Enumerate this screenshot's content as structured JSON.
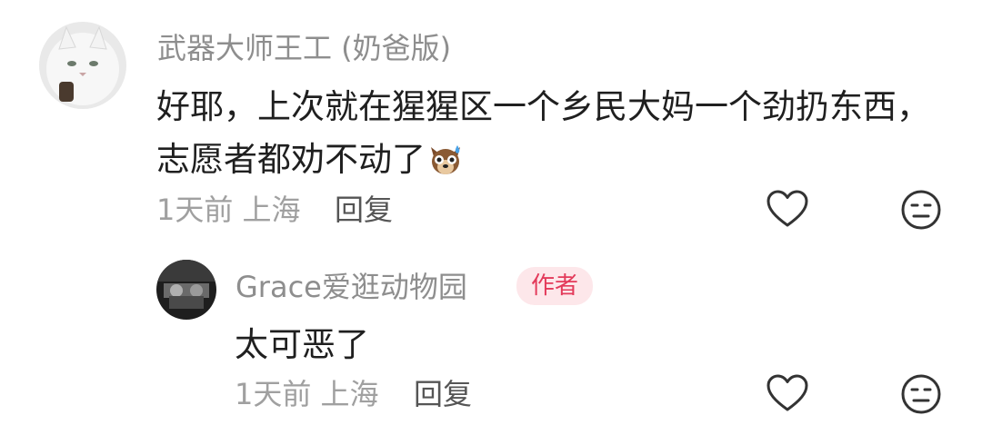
{
  "comment": {
    "author": "武器大师王工 (奶爸版)",
    "avatar_icon": "white-cat-avatar",
    "text_line1": "好耶，上次就在猩猩区一个乡民大妈一个劲扔东西，",
    "text_line2": "志愿者都劝不动了",
    "emoji_icon": "sweating-dog-emoji",
    "time": "1天前",
    "location": "上海",
    "reply_label": "回复",
    "like_icon": "heart-icon",
    "dislike_icon": "neutral-face-icon"
  },
  "reply": {
    "author": "Grace爱逛动物园",
    "avatar_icon": "photo-avatar",
    "badge": "作者",
    "text": "太可恶了",
    "time": "1天前",
    "location": "上海",
    "reply_label": "回复",
    "like_icon": "heart-icon",
    "dislike_icon": "neutral-face-icon"
  },
  "colors": {
    "name": "#8e8e8e",
    "text": "#1f1f1f",
    "meta": "#a0a0a0",
    "badge_bg": "#fde7ea",
    "badge_text": "#e33a5a"
  }
}
